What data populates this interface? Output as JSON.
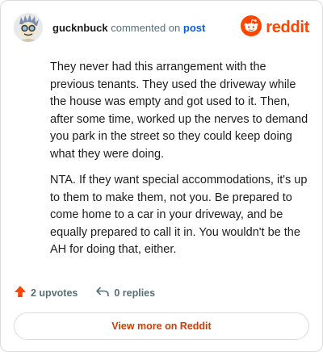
{
  "header": {
    "username": "gucknbuck",
    "action_text": "commented on",
    "post_link": "post"
  },
  "brand": {
    "name": "reddit",
    "color": "#ff4500"
  },
  "comment": {
    "paragraphs": [
      "They never had this arrangement with the previous tenants. They used the driveway while the house was empty and got used to it. Then, after some time, worked up the nerves to demand you park in the street so they could keep doing what they were doing.",
      "NTA. If they want special accommodations, it's up to them to make them, not you. Be prepared to come home to a car in your driveway, and be equally prepared to call it in. You wouldn't be the AH for doing that, either."
    ]
  },
  "actions": {
    "upvotes": "2 upvotes",
    "replies": "0 replies"
  },
  "footer": {
    "more_label": "View more on Reddit"
  },
  "icons": {
    "upvote": "upvote-arrow-icon",
    "reply": "reply-arrow-icon",
    "brand": "reddit-snoo-icon",
    "avatar": "user-avatar"
  }
}
